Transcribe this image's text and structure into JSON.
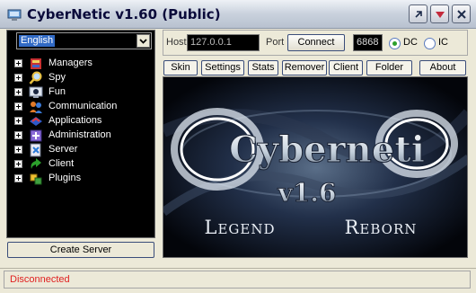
{
  "window": {
    "title": "CyberNetic v1.60 (Public)"
  },
  "sidebar": {
    "language_selected": "English",
    "tree_items": [
      {
        "label": "Managers",
        "icon": "managers-icon"
      },
      {
        "label": "Spy",
        "icon": "magnifier-icon"
      },
      {
        "label": "Fun",
        "icon": "fun-icon"
      },
      {
        "label": "Communication",
        "icon": "users-icon"
      },
      {
        "label": "Applications",
        "icon": "applications-icon"
      },
      {
        "label": "Administration",
        "icon": "administration-icon"
      },
      {
        "label": "Server",
        "icon": "server-icon"
      },
      {
        "label": "Client",
        "icon": "client-icon"
      },
      {
        "label": "Plugins",
        "icon": "plugins-icon"
      }
    ],
    "create_button": "Create Server"
  },
  "connection": {
    "host_label": "Host",
    "host_value": "127.0.0.1",
    "port_label": "Port",
    "connect_label": "Connect",
    "port_value": "6868",
    "dc_label": "DC",
    "ic_label": "IC",
    "selected_mode": "DC"
  },
  "tabs": [
    "Skin",
    "Settings",
    "Stats",
    "Remover",
    "Client",
    "Folder",
    "About"
  ],
  "banner": {
    "logo_text": "Cyberneti",
    "version_text": "v1.6",
    "left_tagline": "Legend",
    "right_tagline": "Reborn"
  },
  "status": {
    "text": "Disconnected",
    "color": "#e02020"
  },
  "colors": {
    "selection": "#316ac5",
    "radio_on": "#2ca02c"
  }
}
